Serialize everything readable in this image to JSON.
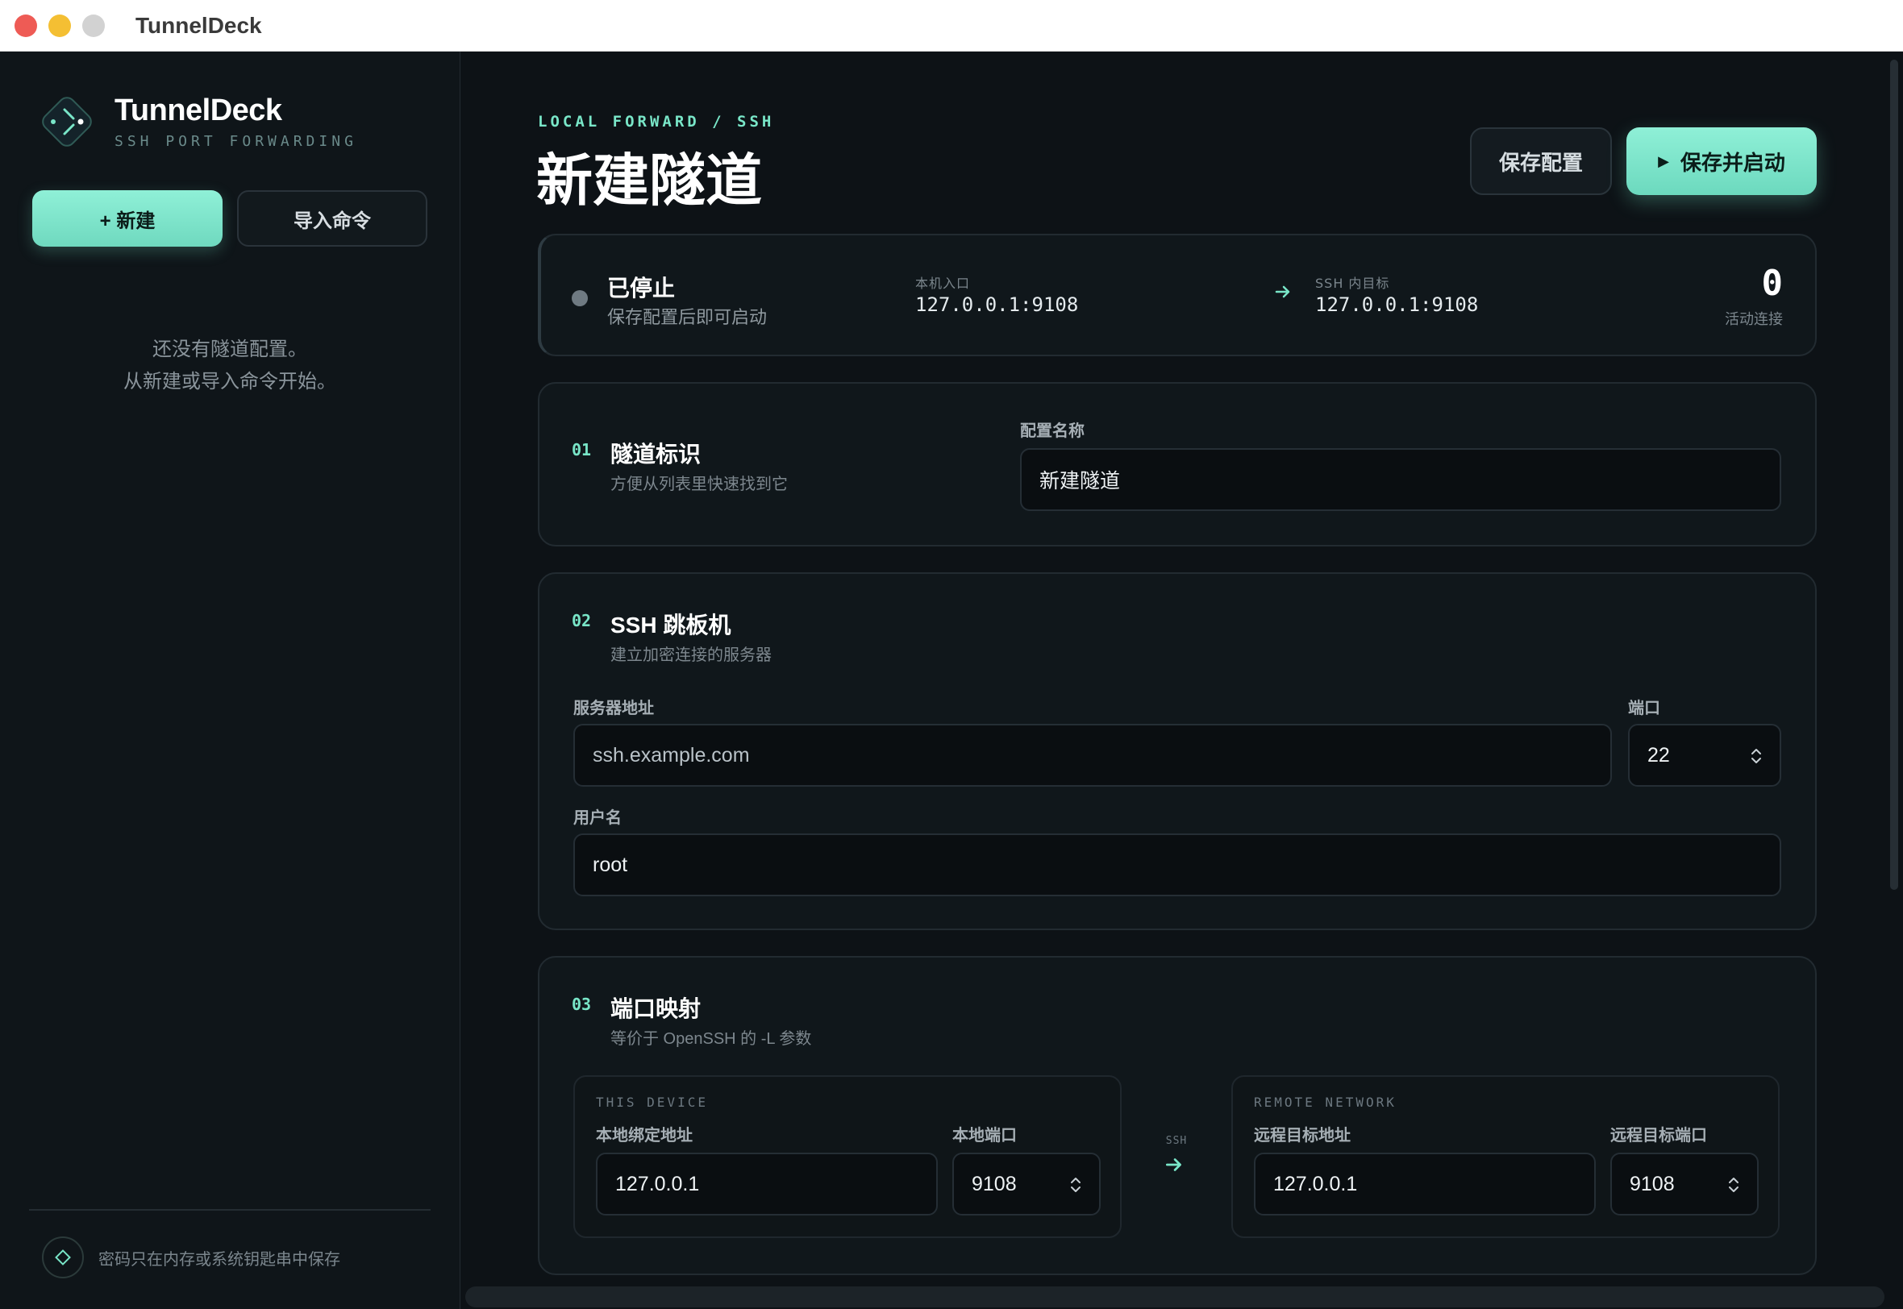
{
  "window": {
    "title": "TunnelDeck"
  },
  "brand": {
    "name": "TunnelDeck",
    "tagline": "SSH PORT FORWARDING"
  },
  "sidebar": {
    "new_label": "+ 新建",
    "import_label": "导入命令",
    "empty_line1": "还没有隧道配置。",
    "empty_line2": "从新建或导入命令开始。",
    "footer_note": "密码只在内存或系统钥匙串中保存"
  },
  "header": {
    "crumb": "LOCAL FORWARD / SSH",
    "title": "新建隧道",
    "save_label": "保存配置",
    "start_label": "保存并启动"
  },
  "status": {
    "title": "已停止",
    "subtitle": "保存配置后即可启动",
    "local_label": "本机入口",
    "local_value": "127.0.0.1:9108",
    "target_label": "SSH 内目标",
    "target_value": "127.0.0.1:9108",
    "active_count": "0",
    "active_label": "活动连接"
  },
  "section1": {
    "num": "01",
    "title": "隧道标识",
    "subtitle": "方便从列表里快速找到它",
    "name_label": "配置名称",
    "name_value": "新建隧道"
  },
  "section2": {
    "num": "02",
    "title": "SSH 跳板机",
    "subtitle": "建立加密连接的服务器",
    "host_label": "服务器地址",
    "host_placeholder": "ssh.example.com",
    "port_label": "端口",
    "port_value": "22",
    "user_label": "用户名",
    "user_value": "root"
  },
  "section3": {
    "num": "03",
    "title": "端口映射",
    "subtitle": "等价于 OpenSSH 的 -L 参数",
    "local_panel": {
      "tag": "THIS DEVICE",
      "bind_label": "本地绑定地址",
      "bind_value": "127.0.0.1",
      "port_label": "本地端口",
      "port_value": "9108"
    },
    "via_label": "SSH",
    "remote_panel": {
      "tag": "REMOTE NETWORK",
      "host_label": "远程目标地址",
      "host_value": "127.0.0.1",
      "port_label": "远程目标端口",
      "port_value": "9108"
    }
  },
  "colors": {
    "accent": "#79e6c8",
    "background": "#0d1216",
    "card": "#10171b"
  },
  "icons": {
    "logo": "tunnel-logo-icon",
    "footer": "diamond-icon",
    "arrow": "arrow-right-icon",
    "stepper": "stepper-icon",
    "play": "play-icon"
  }
}
